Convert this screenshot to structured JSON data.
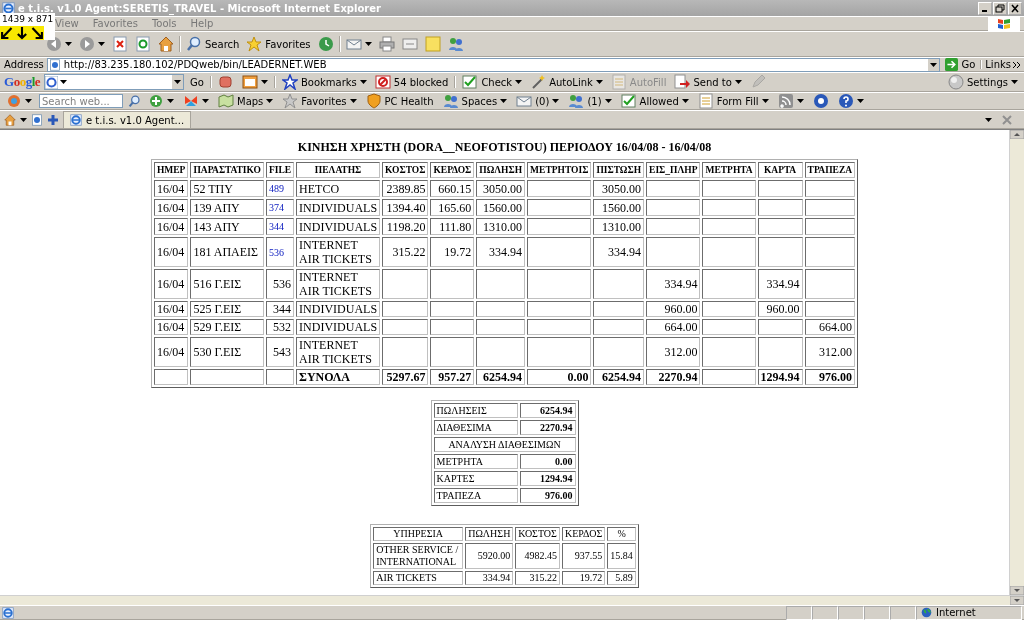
{
  "window": {
    "title": "e t.i.s. v1.0  Agent:SERETIS_TRAVEL - Microsoft Internet Explorer"
  },
  "size_overlay": "1439 x 871",
  "menu": [
    "View",
    "Favorites",
    "Tools",
    "Help"
  ],
  "toolbar": [
    {
      "kind": "back",
      "dropdown": true
    },
    {
      "kind": "forward",
      "dropdown": true
    },
    {
      "kind": "stop",
      "dropdown": false
    },
    {
      "kind": "refresh",
      "dropdown": false
    },
    {
      "kind": "home",
      "dropdown": false
    },
    {
      "kind": "separator"
    },
    {
      "kind": "search",
      "label": "Search",
      "dropdown": false
    },
    {
      "kind": "favorites",
      "label": "Favorites",
      "dropdown": false
    },
    {
      "kind": "history",
      "dropdown": false
    },
    {
      "kind": "separator"
    },
    {
      "kind": "mail",
      "dropdown": true
    },
    {
      "kind": "print",
      "dropdown": false
    },
    {
      "kind": "edit",
      "dropdown": false
    },
    {
      "kind": "note",
      "dropdown": false
    },
    {
      "kind": "messenger",
      "dropdown": false
    }
  ],
  "address": {
    "label": "Address",
    "value": "http://83.235.180.102/PDQweb/bin/LEADERNET.WEB",
    "go": "Go",
    "links": "Links"
  },
  "google_bar": {
    "logo": "Google",
    "go": "Go",
    "items": [
      {
        "kind": "puzzle",
        "dropdown": false,
        "disabled": false
      },
      {
        "kind": "popup",
        "dropdown": true,
        "disabled": false
      },
      {
        "kind": "separator"
      },
      {
        "kind": "bookmark",
        "label": "Bookmarks",
        "dropdown": true,
        "disabled": false
      },
      {
        "kind": "blocked",
        "label": "54 blocked",
        "dropdown": false,
        "disabled": false
      },
      {
        "kind": "separator"
      },
      {
        "kind": "check",
        "label": "Check",
        "dropdown": true,
        "disabled": false
      },
      {
        "kind": "wand",
        "label": "AutoLink",
        "dropdown": true,
        "disabled": false
      },
      {
        "kind": "form",
        "label": "AutoFill",
        "dropdown": false,
        "disabled": true
      },
      {
        "kind": "send",
        "label": "Send to",
        "dropdown": true,
        "disabled": false
      },
      {
        "kind": "pencil",
        "dropdown": false,
        "disabled": true
      }
    ],
    "settings": "Settings"
  },
  "msn_bar": {
    "placeholder": "Search web...",
    "items": [
      {
        "kind": "grip",
        "dropdown": true
      },
      {
        "kind": "plus",
        "dropdown": true
      },
      {
        "kind": "butterfly",
        "dropdown": true
      },
      {
        "kind": "map",
        "label": "Maps",
        "dropdown": true
      },
      {
        "kind": "star",
        "label": "Favorites",
        "dropdown": true
      },
      {
        "kind": "shield",
        "label": "PC Health",
        "dropdown": false
      },
      {
        "kind": "people",
        "label": "Spaces",
        "dropdown": true
      },
      {
        "kind": "mail",
        "label": "(0)",
        "dropdown": true
      },
      {
        "kind": "people",
        "label": "(1)",
        "dropdown": true
      },
      {
        "kind": "check",
        "label": "Allowed",
        "dropdown": true
      },
      {
        "kind": "form",
        "label": "Form Fill",
        "dropdown": true
      },
      {
        "kind": "rss",
        "dropdown": true
      },
      {
        "kind": "headset",
        "dropdown": false
      },
      {
        "kind": "help",
        "dropdown": true
      }
    ]
  },
  "tabs": [
    {
      "label": "e t.i.s. v1.0  Agent...",
      "selected": true
    }
  ],
  "report": {
    "title": "ΚΙΝΗΣΗ ΧΡΗΣΤΗ (DORA__NEOFOTISTOU) ΠΕΡΙΟΔΟΥ 16/04/08 - 16/04/08",
    "columns": [
      "ΗΜΕΡ",
      "ΠΑΡΑΣΤΑΤΙΚΟ",
      "FILE",
      "ΠΕΛΑΤΗΣ",
      "ΚΟΣΤΟΣ",
      "ΚΕΡΔΟΣ",
      "ΠΩΛΗΣΗ",
      "ΜΕΤΡΗΤΟΙΣ",
      "ΠΙΣΤΩΣΗ",
      "ΕΙΣ_ΠΛΗΡ",
      "ΜΕΤΡΗΤΑ",
      "ΚΑΡΤΑ",
      "ΤΡΑΠΕΖΑ"
    ],
    "rows": [
      {
        "date": "16/04",
        "doc": "52 ΤΠΥ",
        "file": {
          "text": "489",
          "link": true
        },
        "customer": "HETCO",
        "cost": "2389.85",
        "profit": "660.15",
        "sale": "3050.00",
        "credit": "3050.00"
      },
      {
        "date": "16/04",
        "doc": "139 ΑΠΥ",
        "file": {
          "text": "374",
          "link": true
        },
        "customer": "INDIVIDUALS",
        "cost": "1394.40",
        "profit": "165.60",
        "sale": "1560.00",
        "credit": "1560.00"
      },
      {
        "date": "16/04",
        "doc": "143 ΑΠΥ",
        "file": {
          "text": "344",
          "link": true
        },
        "customer": "INDIVIDUALS",
        "cost": "1198.20",
        "profit": "111.80",
        "sale": "1310.00",
        "credit": "1310.00"
      },
      {
        "date": "16/04",
        "doc": "181 ΑΠΑΕΙΣ",
        "file": {
          "text": "536",
          "link": true
        },
        "customer": "INTERNET AIR TICKETS",
        "cost": "315.22",
        "profit": "19.72",
        "sale": "334.94",
        "credit": "334.94"
      },
      {
        "date": "16/04",
        "doc": "516 Γ.ΕΙΣ",
        "file": {
          "text": "536",
          "link": false
        },
        "customer": "INTERNET AIR TICKETS",
        "receipts": "334.94",
        "card": "334.94"
      },
      {
        "date": "16/04",
        "doc": "525 Γ.ΕΙΣ",
        "file": {
          "text": "344",
          "link": false
        },
        "customer": "INDIVIDUALS",
        "receipts": "960.00",
        "card": "960.00"
      },
      {
        "date": "16/04",
        "doc": "529 Γ.ΕΙΣ",
        "file": {
          "text": "532",
          "link": false
        },
        "customer": "INDIVIDUALS",
        "receipts": "664.00",
        "bank": "664.00"
      },
      {
        "date": "16/04",
        "doc": "530 Γ.ΕΙΣ",
        "file": {
          "text": "543",
          "link": false
        },
        "customer": "INTERNET AIR TICKETS",
        "receipts": "312.00",
        "bank": "312.00"
      }
    ],
    "totals": {
      "label": "ΣΥΝΟΛΑ",
      "cost": "5297.67",
      "profit": "957.27",
      "sale": "6254.94",
      "cash_payer": "0.00",
      "credit": "6254.94",
      "receipts": "2270.94",
      "card": "1294.94",
      "bank": "976.00"
    },
    "summary": [
      {
        "kind": "pair",
        "label": "ΠΩΛΗΣΕΙΣ",
        "value": "6254.94"
      },
      {
        "kind": "pair",
        "label": "ΔΙΑΘΕΣΙΜΑ",
        "value": "2270.94"
      },
      {
        "kind": "section",
        "label": "ΑΝΑΛΥΣΗ ΔΙΑΘΕΣΙΜΩΝ"
      },
      {
        "kind": "pair",
        "label": "ΜΕΤΡΗΤΑ",
        "value": "0.00"
      },
      {
        "kind": "pair",
        "label": "ΚΑΡΤΕΣ",
        "value": "1294.94"
      },
      {
        "kind": "pair",
        "label": "ΤΡΑΠΕΖΑ",
        "value": "976.00"
      }
    ],
    "services": {
      "columns": [
        "ΥΠΗΡΕΣΙΑ",
        "ΠΩΛΗΣΗ",
        "ΚΟΣΤΟΣ",
        "ΚΕΡΔΟΣ",
        "%"
      ],
      "rows": [
        [
          "OTHER SERVICE / INTERNATIONAL",
          "5920.00",
          "4982.45",
          "937.55",
          "15.84"
        ],
        [
          "AIR TICKETS",
          "334.94",
          "315.22",
          "19.72",
          "5.89"
        ]
      ]
    }
  },
  "status_bar": {
    "zone": "Internet"
  }
}
